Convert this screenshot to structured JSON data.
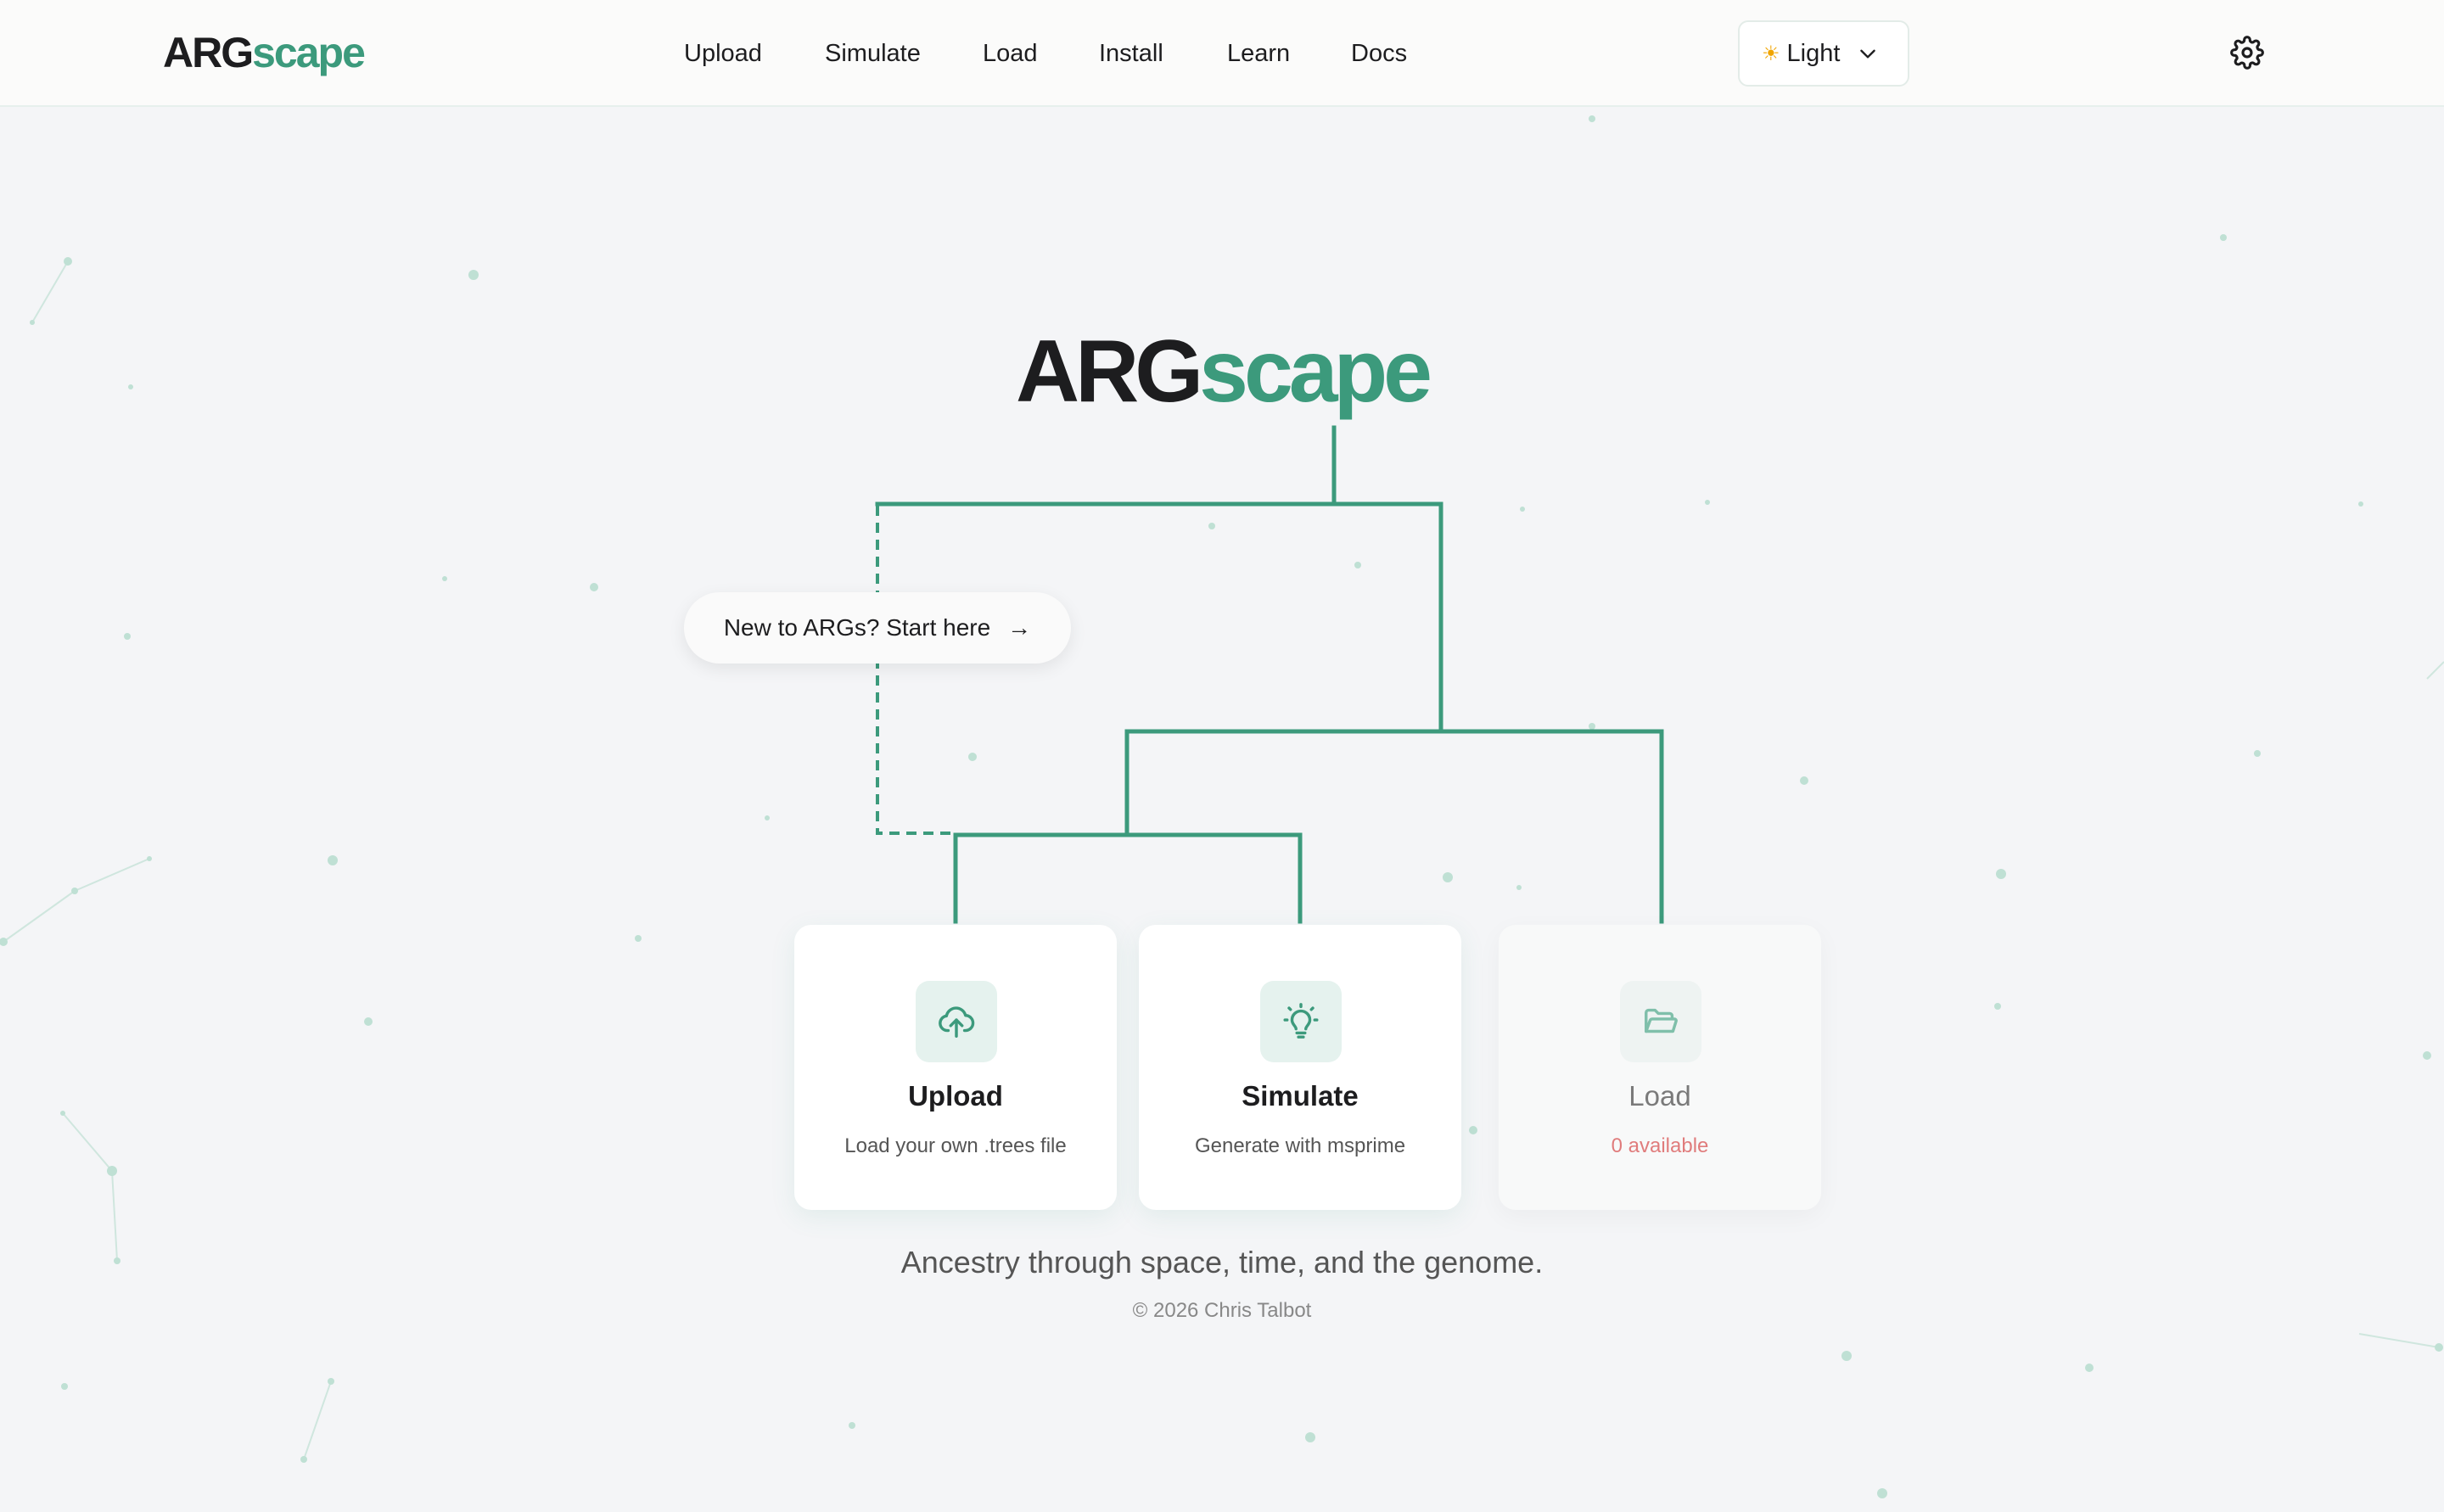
{
  "brand": {
    "part1": "ARG",
    "part2": "scape"
  },
  "colors": {
    "accent": "#3c9a7c",
    "danger_text": "#e07c7c",
    "background": "#f4f5f7"
  },
  "nav": {
    "links": [
      "Upload",
      "Simulate",
      "Load",
      "Install",
      "Learn",
      "Docs"
    ],
    "theme": {
      "icon": "sun-icon",
      "label": "Light"
    },
    "settings_icon": "gear-icon"
  },
  "hero": {
    "start_label": "New to ARGs? Start here",
    "start_arrow": "→"
  },
  "cards": [
    {
      "icon": "cloud-upload-icon",
      "title": "Upload",
      "subtitle": "Load your own .trees file"
    },
    {
      "icon": "lightbulb-icon",
      "title": "Simulate",
      "subtitle": "Generate with msprime"
    },
    {
      "icon": "folder-open-icon",
      "title": "Load",
      "subtitle": "0 available"
    }
  ],
  "tagline": "Ancestry through space, time, and the genome.",
  "copyright": "© 2026 Chris Talbot"
}
